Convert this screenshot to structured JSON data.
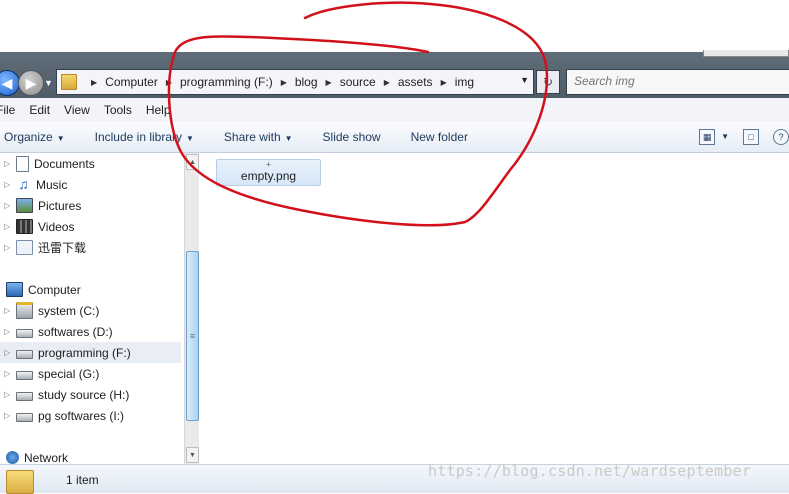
{
  "address_bar": {
    "breadcrumbs": [
      "Computer",
      "programming (F:)",
      "blog",
      "source",
      "assets",
      "img"
    ]
  },
  "search": {
    "placeholder": "Search img"
  },
  "menu": {
    "items": [
      "File",
      "Edit",
      "View",
      "Tools",
      "Help"
    ]
  },
  "commands": {
    "organize": "Organize",
    "include_in_library": "Include in library",
    "share_with": "Share with",
    "slide_show": "Slide show",
    "new_folder": "New folder"
  },
  "nav": {
    "libraries": [
      "Documents",
      "Music",
      "Pictures",
      "Videos",
      "迅雷下载"
    ],
    "computer_label": "Computer",
    "drives": [
      "system (C:)",
      "softwares (D:)",
      "programming (F:)",
      "special (G:)",
      "study source (H:)",
      "pg softwares (I:)"
    ],
    "network_label": "Network"
  },
  "content": {
    "files": [
      "empty.png"
    ]
  },
  "status": {
    "item_count": "1 item"
  },
  "watermark": "https://blog.csdn.net/wardseptember",
  "colors": {
    "annotation": "#d2111b",
    "accent": "#1e395b"
  }
}
